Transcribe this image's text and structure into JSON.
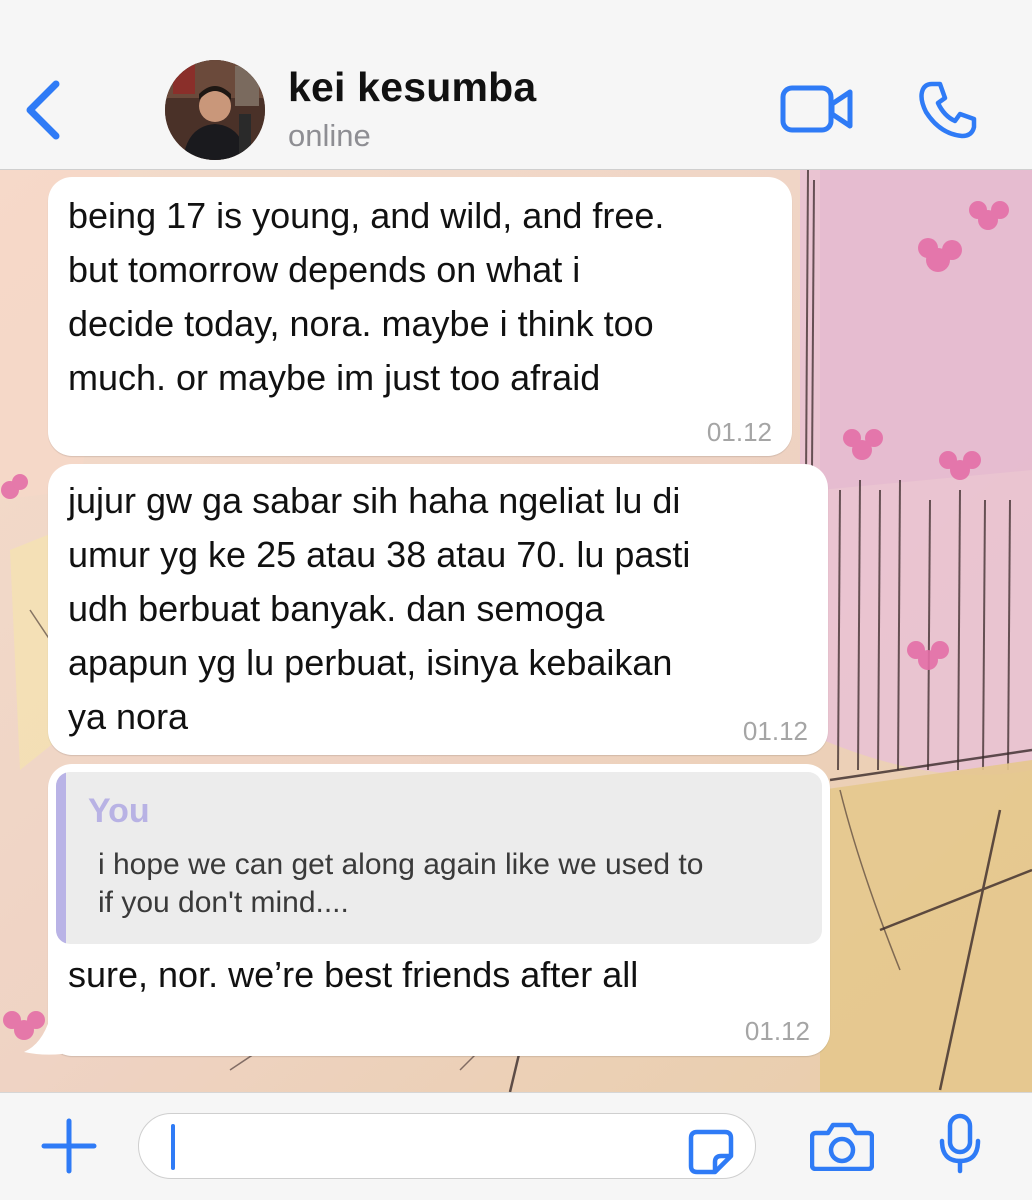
{
  "header": {
    "contact_name": "kei kesumba",
    "status": "online",
    "back_icon": "chevron-left-icon",
    "video_icon": "video-camera-icon",
    "call_icon": "phone-icon"
  },
  "messages": [
    {
      "text": "being 17 is young, and wild, and free.\nbut tomorrow depends on what i\ndecide today, nora. maybe i think too\nmuch. or maybe im just too afraid",
      "time": "01.12"
    },
    {
      "text": "jujur gw ga sabar sih haha ngeliat lu di\numur yg ke 25 atau 38 atau 70. lu pasti\nudh berbuat banyak. dan semoga\napapun yg lu perbuat, isinya kebaikan\nya nora",
      "time": "01.12"
    },
    {
      "quote_author": "You",
      "quote_text": "i hope we can get along again like we used to\nif you don't mind....",
      "text": "sure, nor. we’re best friends after all",
      "time": "01.12"
    }
  ],
  "input": {
    "placeholder": "",
    "value": ""
  },
  "colors": {
    "accent": "#2f7bf6",
    "quote_accent": "#b8b2e4",
    "bubble": "#ffffff",
    "timestamp": "#a5a5a5"
  }
}
